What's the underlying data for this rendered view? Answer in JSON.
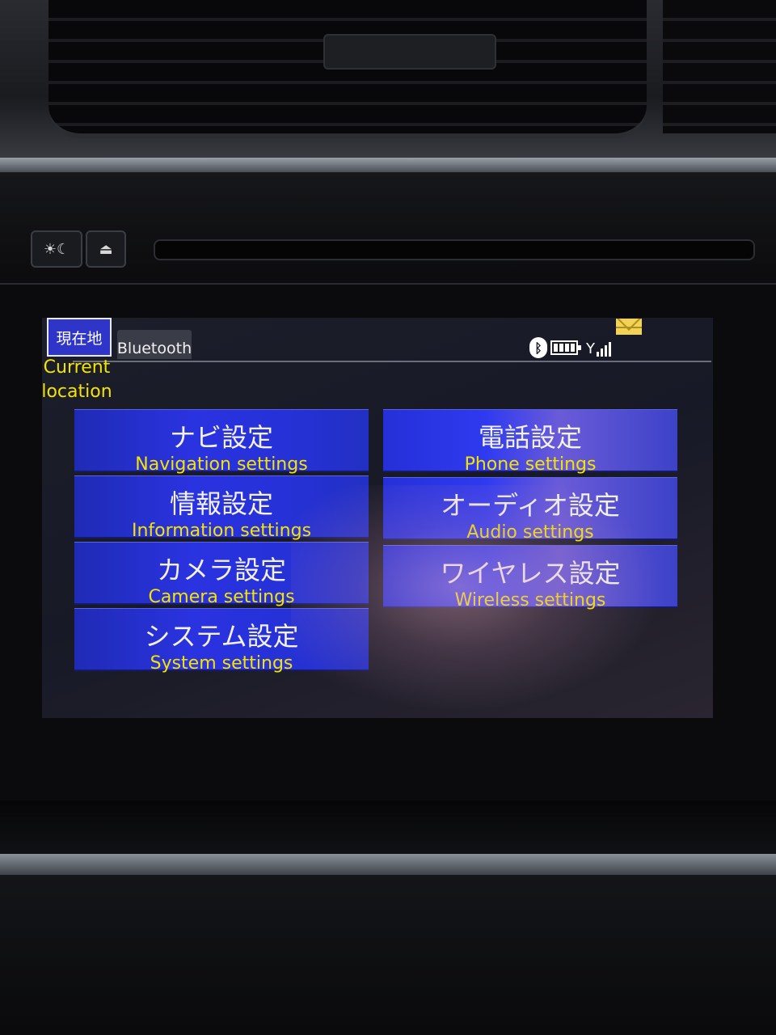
{
  "hardware": {
    "day_night_icon": "☀☾",
    "eject_icon": "⏏"
  },
  "header": {
    "current_location_label": "現在地",
    "current_location_annotation_line1": "Current",
    "current_location_annotation_line2": "location",
    "bluetooth_tab_label": "Bluetooth",
    "status_icons": [
      "bluetooth-icon",
      "battery-icon",
      "signal-icon",
      "mail-icon"
    ]
  },
  "menu": {
    "items": [
      {
        "jp": "ナビ設定",
        "en": "Navigation settings"
      },
      {
        "jp": "電話設定",
        "en": "Phone settings"
      },
      {
        "jp": "情報設定",
        "en": "Information settings"
      },
      {
        "jp": "オーディオ設定",
        "en": "Audio settings"
      },
      {
        "jp": "カメラ設定",
        "en": "Camera settings"
      },
      {
        "jp": "ワイヤレス設定",
        "en": "Wireless settings"
      },
      {
        "jp": "システム設定",
        "en": "System settings"
      }
    ]
  },
  "colors": {
    "button_blue": "#2a33e0",
    "annotation_yellow": "#f5e400",
    "location_button": "#2f35c8",
    "mail_yellow": "#f1d35a"
  }
}
